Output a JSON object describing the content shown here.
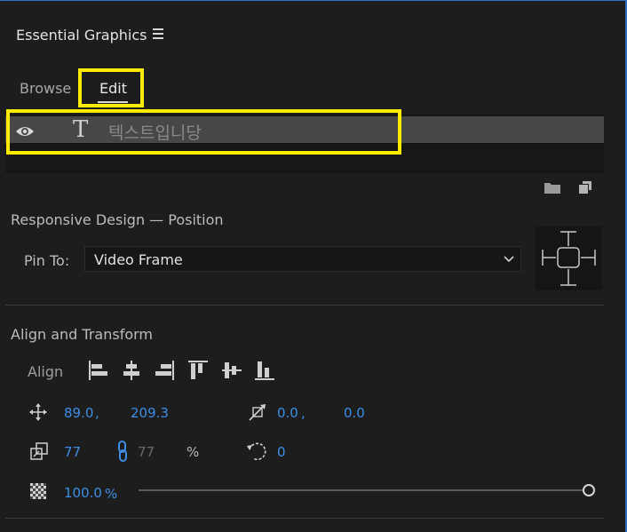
{
  "panel": {
    "title": "Essential Graphics",
    "menu_icon": "hamburger-menu-icon"
  },
  "tabs": [
    {
      "label": "Browse",
      "active": false
    },
    {
      "label": "Edit",
      "active": true
    }
  ],
  "layers": [
    {
      "name": "텍스트입니당",
      "type": "text",
      "visible": true
    }
  ],
  "responsive": {
    "title": "Responsive Design — Position",
    "pin_label": "Pin To:",
    "pin_value": "Video Frame"
  },
  "align_transform": {
    "title": "Align and Transform",
    "align_label": "Align",
    "position": {
      "x": "89.0",
      "sep": ",",
      "y": "209.3"
    },
    "anchor": {
      "x": "0.0",
      "sep": ",",
      "y": "0.0"
    },
    "scale": {
      "width": "77",
      "height": "77",
      "unit": "%"
    },
    "rotation": "0",
    "opacity": {
      "value": "100.0",
      "unit": "%",
      "level": 1.0
    }
  },
  "colors": {
    "accent_blue": "#3d8ee6",
    "highlight_yellow": "#ffec00",
    "panel_bg": "#1d1d1d"
  }
}
